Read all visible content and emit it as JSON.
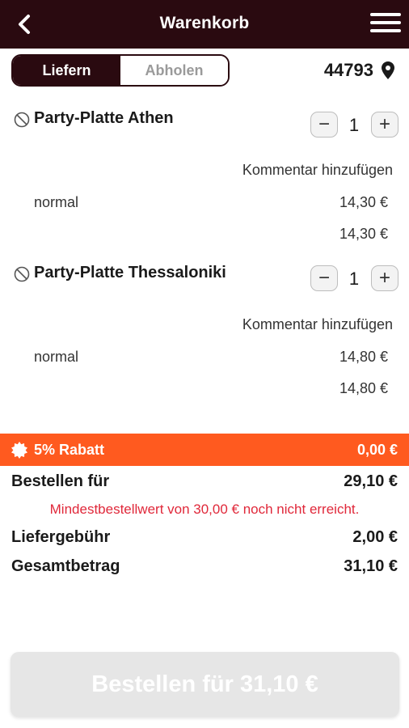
{
  "header": {
    "title": "Warenkorb",
    "back_icon": "chevron-left-icon",
    "menu_icon": "hamburger-menu-icon"
  },
  "delivery_toggle": {
    "options": [
      "Liefern",
      "Abholen"
    ],
    "selected": "Liefern"
  },
  "location": {
    "zip": "44793",
    "icon": "map-pin-icon"
  },
  "cart": {
    "items": [
      {
        "name": "Party-Platte Athen",
        "quantity": "1",
        "comment_label": "Kommentar hinzufügen",
        "variant": "normal",
        "variant_price": "14,30 €",
        "total": "14,30 €"
      },
      {
        "name": "Party-Platte Thessaloniki",
        "quantity": "1",
        "comment_label": "Kommentar hinzufügen",
        "variant": "normal",
        "variant_price": "14,80 €",
        "total": "14,80 €"
      }
    ]
  },
  "discount": {
    "label": "5% Rabatt",
    "value": "0,00 €",
    "color": "#ff5a1f"
  },
  "summary": {
    "subtotal_label": "Bestellen für",
    "subtotal_value": "29,10 €",
    "warning": "Mindestbestellwert von 30,00 € noch nicht erreicht.",
    "delivery_fee_label": "Liefergebühr",
    "delivery_fee_value": "2,00 €",
    "total_label": "Gesamtbetrag",
    "total_value": "31,10 €"
  },
  "order_button": {
    "label": "Bestellen für 31,10 €"
  },
  "colors": {
    "header_bg": "#2a0a10",
    "warning": "#e0283a",
    "button_disabled": "#e6e6e6"
  }
}
